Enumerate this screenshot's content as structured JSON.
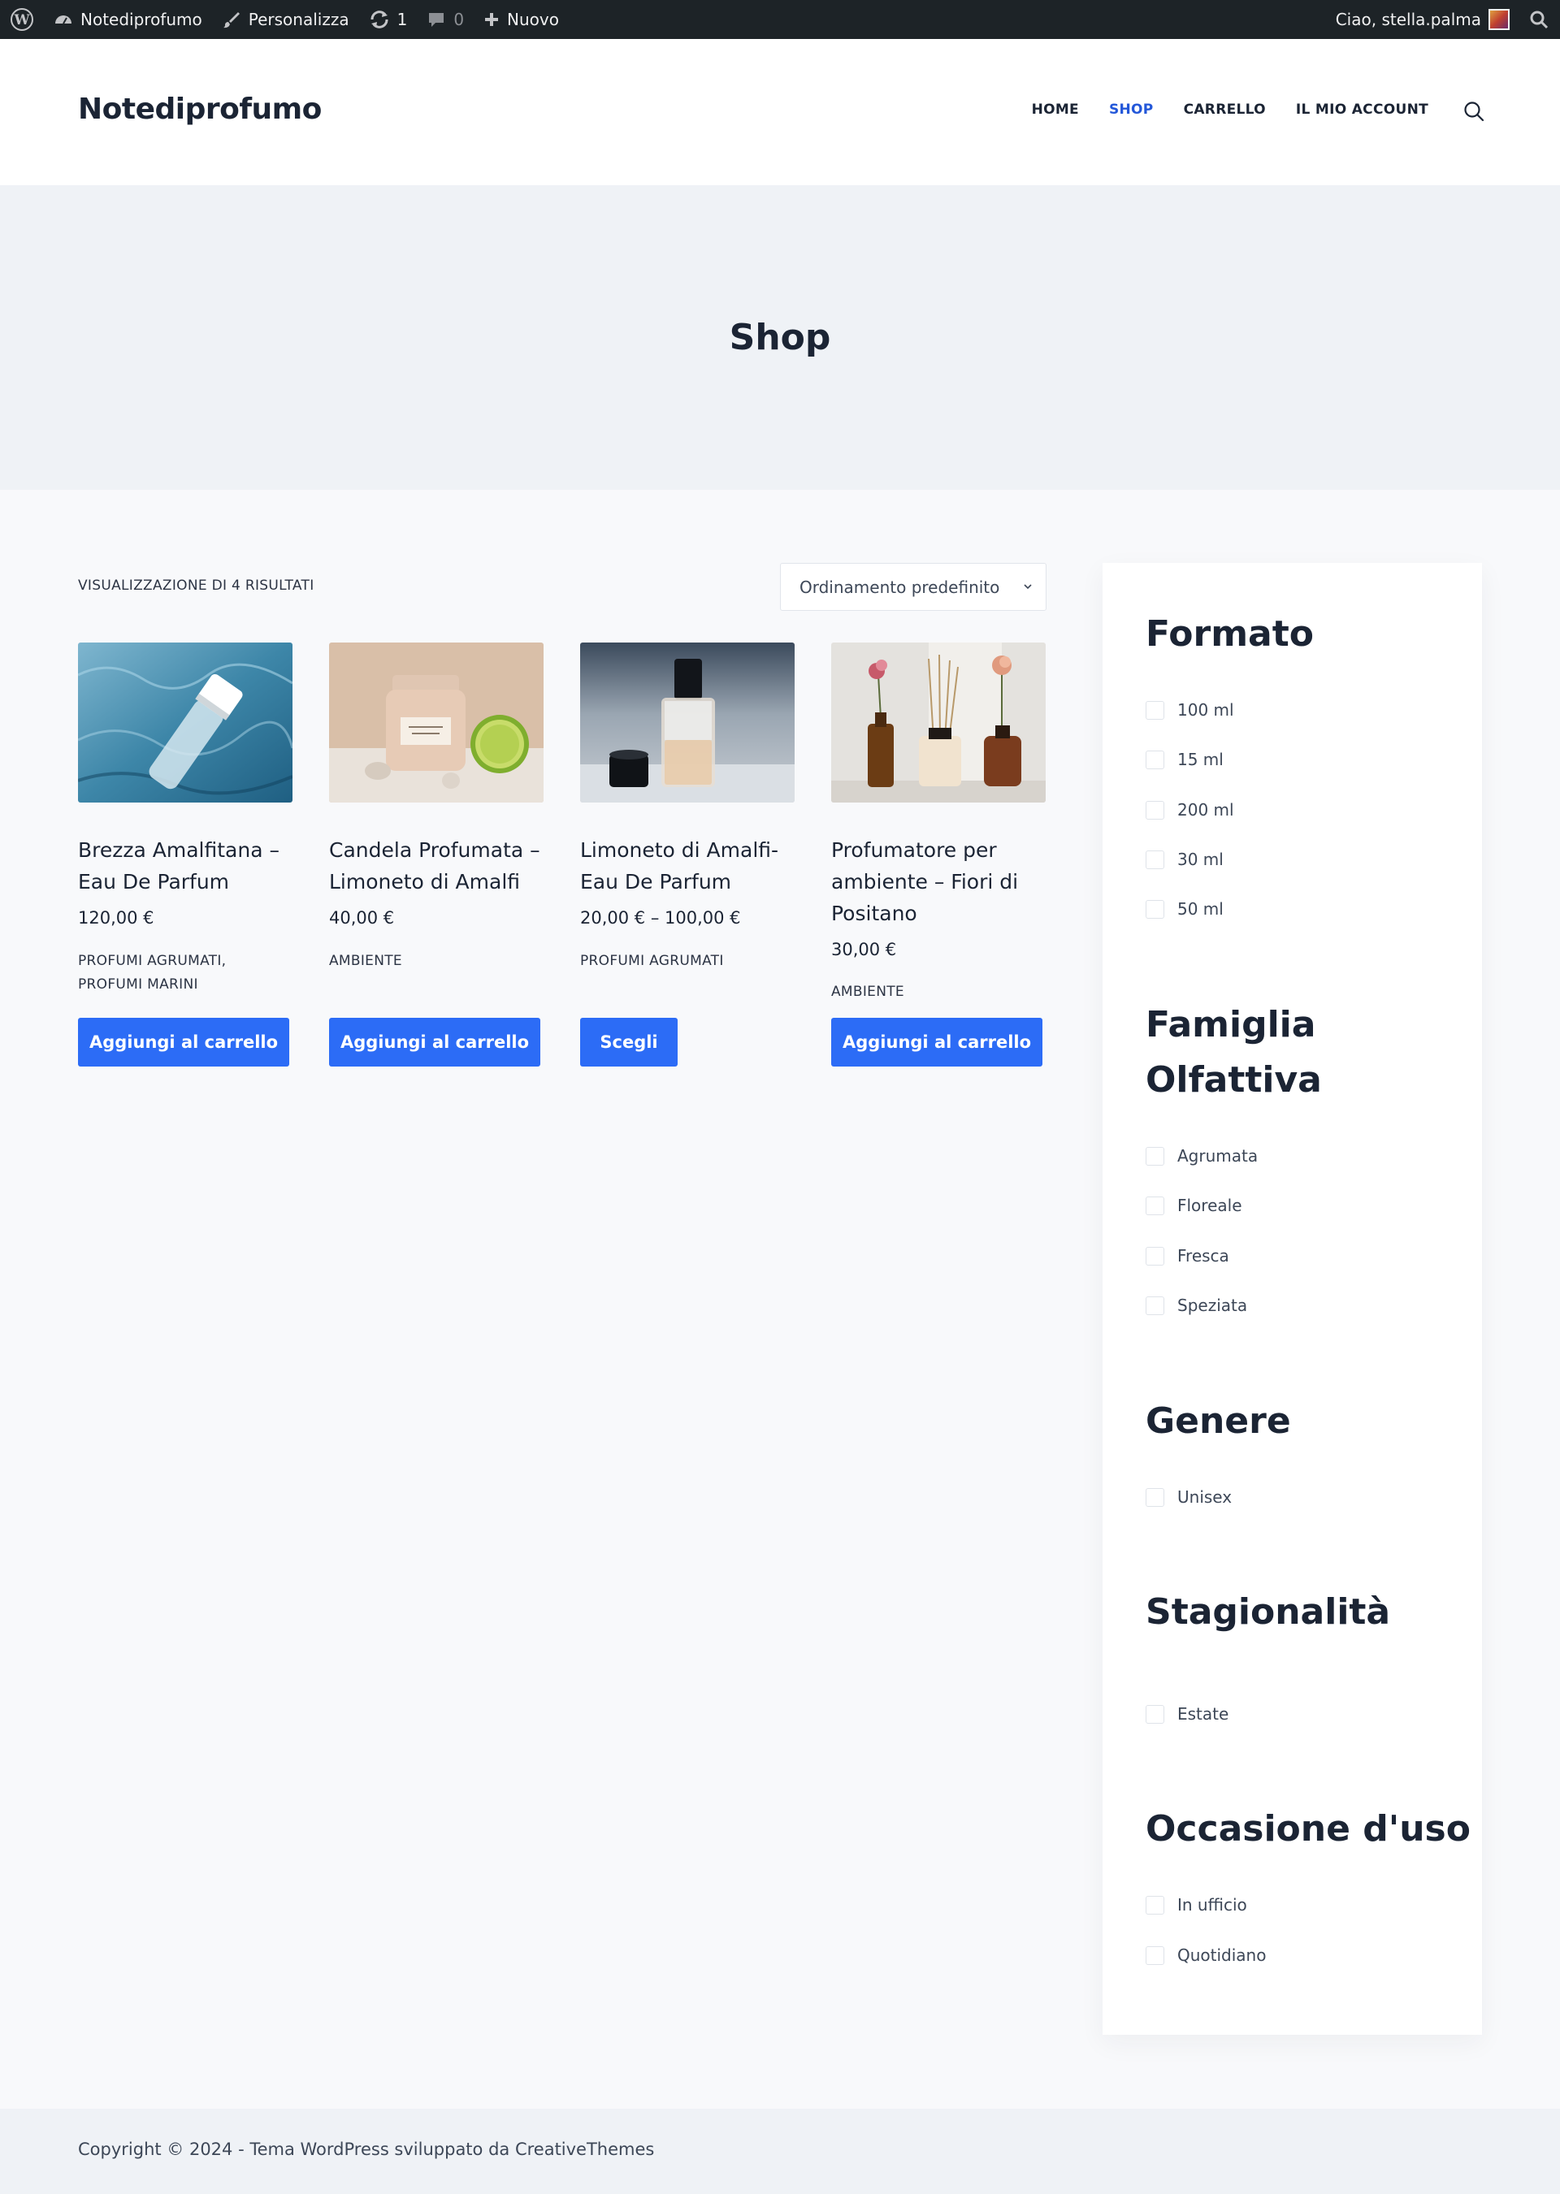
{
  "admin_bar": {
    "site_name": "Notediprofumo",
    "customize": "Personalizza",
    "updates_count": "1",
    "comments_count": "0",
    "new_label": "Nuovo",
    "greeting": "Ciao, stella.palma"
  },
  "header": {
    "site_title": "Notediprofumo",
    "nav": [
      "HOME",
      "SHOP",
      "CARRELLO",
      "IL MIO ACCOUNT"
    ],
    "active_nav": "SHOP"
  },
  "hero": {
    "title": "Shop"
  },
  "toolbar": {
    "result_count": "VISUALIZZAZIONE DI 4 RISULTATI",
    "ordering": "Ordinamento predefinito"
  },
  "products": [
    {
      "name": "Brezza Amalfitana – Eau De Parfum",
      "price": "120,00 €",
      "categories": "PROFUMI AGRUMATI, PROFUMI MARINI",
      "button": "Aggiungi al carrello"
    },
    {
      "name": "Candela Profumata – Limoneto di Amalfi",
      "price": "40,00 €",
      "categories": "AMBIENTE",
      "button": "Aggiungi al carrello"
    },
    {
      "name": "Limoneto di Amalfi- Eau De Parfum",
      "price": "20,00 € – 100,00 €",
      "categories": "PROFUMI AGRUMATI",
      "button": "Scegli"
    },
    {
      "name": "Profumatore per ambiente – Fiori di Positano",
      "price": "30,00 €",
      "categories": "AMBIENTE",
      "button": "Aggiungi al carrello"
    }
  ],
  "sidebar": {
    "widgets": [
      {
        "title": "Formato",
        "items": [
          "100 ml",
          "15 ml",
          "200 ml",
          "30 ml",
          "50 ml"
        ]
      },
      {
        "title": "Famiglia Olfattiva",
        "items": [
          "Agrumata",
          "Floreale",
          "Fresca",
          "Speziata"
        ]
      },
      {
        "title": "Genere",
        "items": [
          "Unisex"
        ]
      },
      {
        "title": "Stagionalità",
        "items": [
          "Estate"
        ]
      },
      {
        "title": "Occasione d'uso",
        "items": [
          "In ufficio",
          "Quotidiano"
        ]
      }
    ]
  },
  "footer": {
    "copyright": "Copyright © 2024 - Tema WordPress sviluppato da CreativeThemes"
  },
  "colors": {
    "accent": "#2c6cf6",
    "nav_active": "#2357d9",
    "admin_bar": "#1d2327",
    "hero_bg": "#eff2f6"
  }
}
